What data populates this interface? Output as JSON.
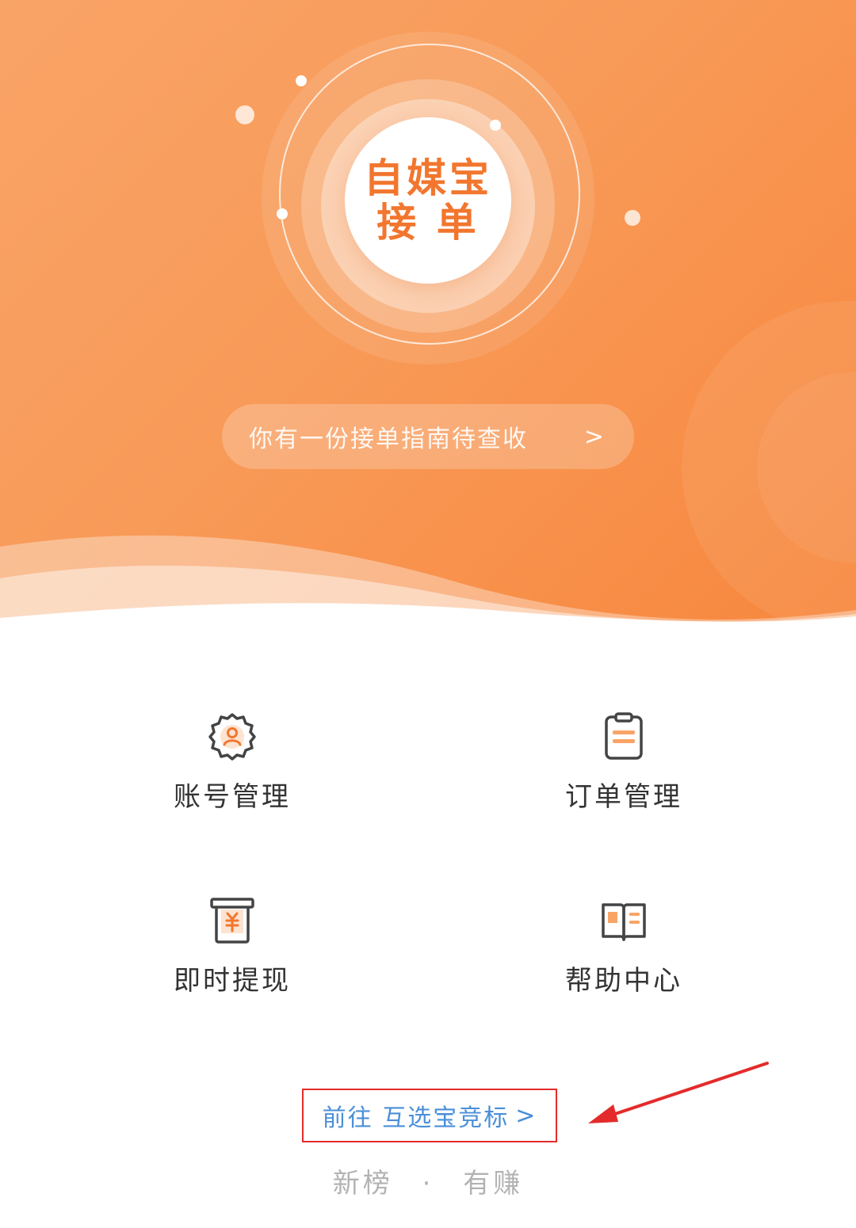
{
  "hero": {
    "logo_line1": "自媒宝",
    "logo_line2": "接 单",
    "guide_text": "你有一份接单指南待查收",
    "guide_arrow": ">"
  },
  "menu": [
    {
      "label": "账号管理",
      "icon": "account-gear-icon"
    },
    {
      "label": "订单管理",
      "icon": "clipboard-icon"
    },
    {
      "label": "即时提现",
      "icon": "withdraw-yuan-icon"
    },
    {
      "label": "帮助中心",
      "icon": "open-book-icon"
    }
  ],
  "footer": {
    "goto_label": "前往 互选宝竞标",
    "goto_arrow": ">",
    "tagline_left": "新榜",
    "tagline_sep": "·",
    "tagline_right": "有赚"
  },
  "colors": {
    "brand_orange": "#f7873d",
    "logo_text": "#f2762e",
    "link_blue": "#4a8fd9",
    "highlight_red": "#e32b2b"
  }
}
